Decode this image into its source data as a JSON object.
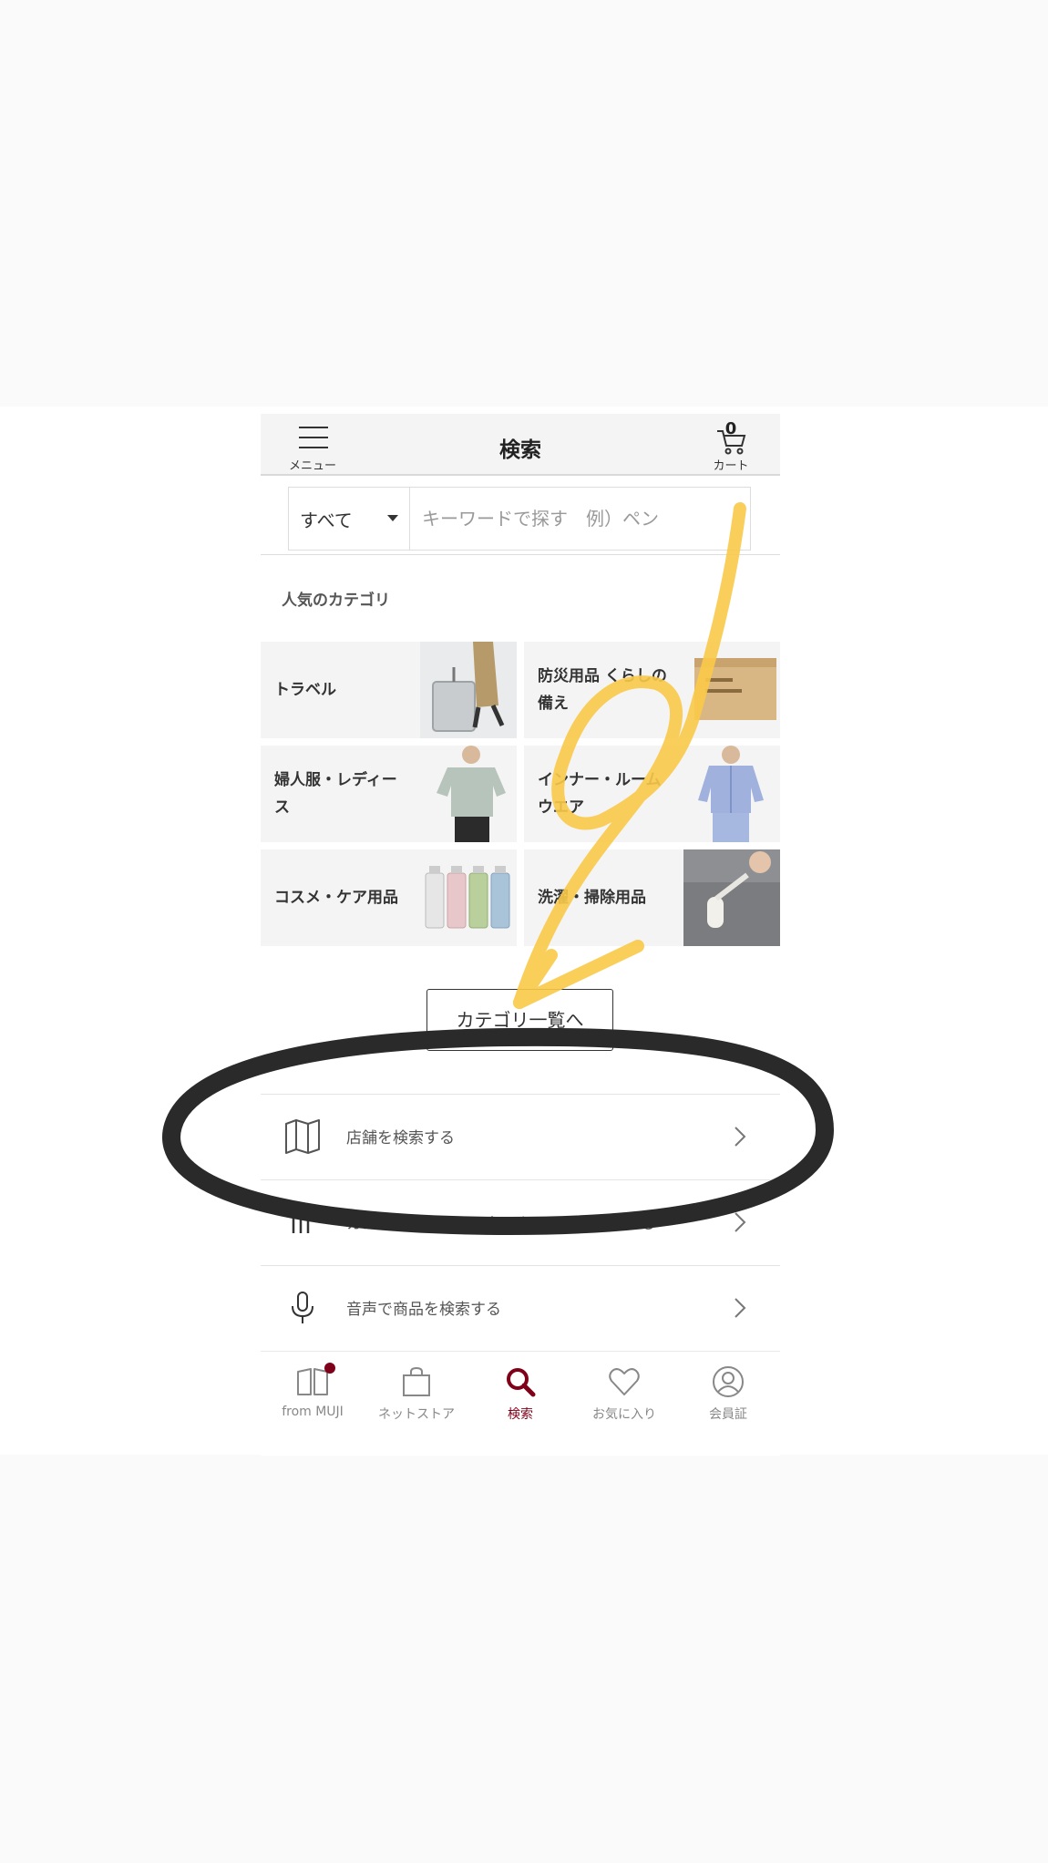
{
  "header": {
    "title": "検索",
    "menu_label": "メニュー",
    "cart_label": "カート",
    "cart_count": "0"
  },
  "search": {
    "scope_value": "すべて",
    "placeholder": "キーワードで探す　例）ペン",
    "value": ""
  },
  "popular": {
    "title": "人気のカテゴリ",
    "categories": [
      {
        "label": "トラベル",
        "icon": "suitcase-photo"
      },
      {
        "label": "防災用品 くらしの備え",
        "icon": "cardboard-box-photo"
      },
      {
        "label": "婦人服・レディース",
        "icon": "womens-shirt-photo"
      },
      {
        "label": "インナー・ルームウエア",
        "icon": "pajama-photo"
      },
      {
        "label": "コスメ・ケア用品",
        "icon": "cosmetic-bottles-photo"
      },
      {
        "label": "洗濯・掃除用品",
        "icon": "lint-roller-photo"
      }
    ]
  },
  "category_all_button": "カテゴリ一覧へ",
  "actions": [
    {
      "label": "店舗を検索する",
      "icon": "map-icon"
    },
    {
      "label": "カメラでバーコードをスキャンして検索する",
      "icon": "barcode-icon"
    },
    {
      "label": "音声で商品を検索する",
      "icon": "microphone-icon"
    }
  ],
  "tabbar": {
    "items": [
      {
        "label": "from MUJI",
        "icon": "book-icon",
        "has_badge": true
      },
      {
        "label": "ネットストア",
        "icon": "shopping-bag-icon"
      },
      {
        "label": "検索",
        "icon": "search-icon",
        "active": true
      },
      {
        "label": "お気に入り",
        "icon": "heart-icon"
      },
      {
        "label": "会員証",
        "icon": "user-icon"
      }
    ],
    "active_color": "#7f0019"
  },
  "annotations": {
    "arrow_color": "#f9c948",
    "circle_color": "#2a2a2a"
  }
}
